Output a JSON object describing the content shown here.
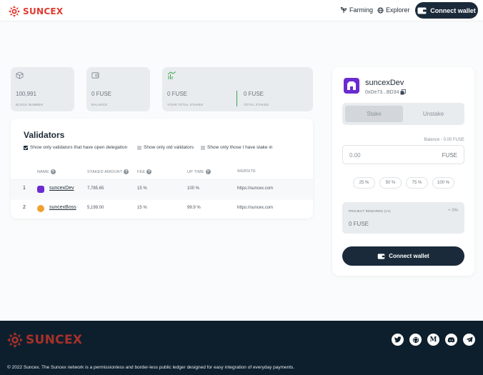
{
  "header": {
    "logo_text": "SUNCEX",
    "nav": [
      {
        "label": "Farming",
        "icon": "sprout-icon"
      },
      {
        "label": "Explorer",
        "icon": "globe-icon"
      }
    ],
    "connect_label": "Connect wallet"
  },
  "stats": [
    {
      "value": "100,991",
      "label": "BLOCK NUMBER",
      "icon": "cube-icon"
    },
    {
      "value": "0 FUSE",
      "label": "BALANCE",
      "icon": "wallet-icon"
    },
    {
      "value": "0 FUSE",
      "label": "YOUR TOTAL STAKED",
      "icon": "stake-icon"
    },
    {
      "value": "0 FUSE",
      "label": "TOTAL STAKED"
    }
  ],
  "validators": {
    "title": "Validators",
    "filters": [
      {
        "label": "Show only validators that have open delegation",
        "checked": true
      },
      {
        "label": "Show only old validators",
        "checked": false
      },
      {
        "label": "Show only those I have stake in",
        "checked": false
      }
    ],
    "columns": [
      "NAME",
      "STAKED AMOUNT",
      "FEE",
      "UP TIME",
      "WEBSITE"
    ],
    "rows": [
      {
        "index": "1",
        "name": "suncexDev",
        "staked": "7,785.65",
        "fee": "15 %",
        "uptime": "100 %",
        "website": "https://suncex.com",
        "avatar_color": "#6a2bd0"
      },
      {
        "index": "2",
        "name": "suncexBoss",
        "staked": "5,199.00",
        "fee": "15 %",
        "uptime": "99.9 %",
        "website": "https://suncex.com",
        "avatar_color": "#f0a030"
      }
    ]
  },
  "panel": {
    "validator_name": "suncexDev",
    "address": "0xDe73...BD34",
    "tabs": [
      "Stake",
      "Unstake"
    ],
    "balance_text": "Balance - 0.00 FUSE",
    "amount_value": "0.00",
    "amount_unit": "FUSE",
    "percent_options": [
      "25 %",
      "50 %",
      "75 %",
      "100 %"
    ],
    "rewards_label": "PROJECT REWARDS (1Y)",
    "rewards_percent": "+ 0%",
    "rewards_value": "0 FUSE",
    "connect_label": "Connect wallet"
  },
  "footer": {
    "logo_text": "SUNCEX",
    "socials": [
      "twitter-icon",
      "github-icon",
      "medium-icon",
      "discord-icon",
      "telegram-icon"
    ],
    "copyright": "© 2022 Suncex. The Suncex network is a permissionless and border-less public ledger designed for easy integration of everyday payments."
  },
  "colors": {
    "brand_red": "#e03a2e",
    "dark": "#1a2a3a",
    "footer_bg": "#0d1f2d",
    "divider_green": "#3aa24f"
  }
}
